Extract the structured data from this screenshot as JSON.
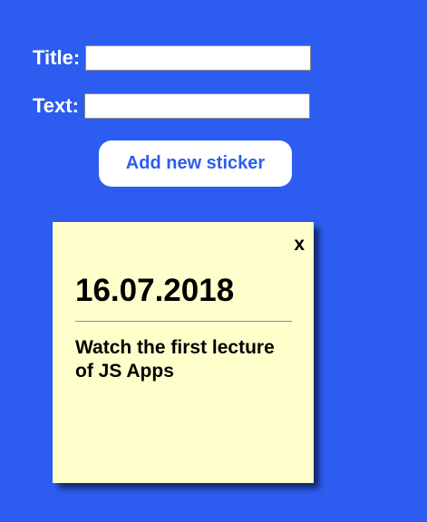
{
  "form": {
    "title_label": "Title:",
    "title_value": "",
    "text_label": "Text:",
    "text_value": "",
    "add_button_label": "Add new sticker"
  },
  "stickers": [
    {
      "close_label": "x",
      "title": "16.07.2018",
      "text": "Watch the first lecture of JS Apps"
    }
  ],
  "colors": {
    "background": "#2c5df0",
    "sticker_background": "#ffffcc",
    "button_text": "#2c5df0"
  }
}
